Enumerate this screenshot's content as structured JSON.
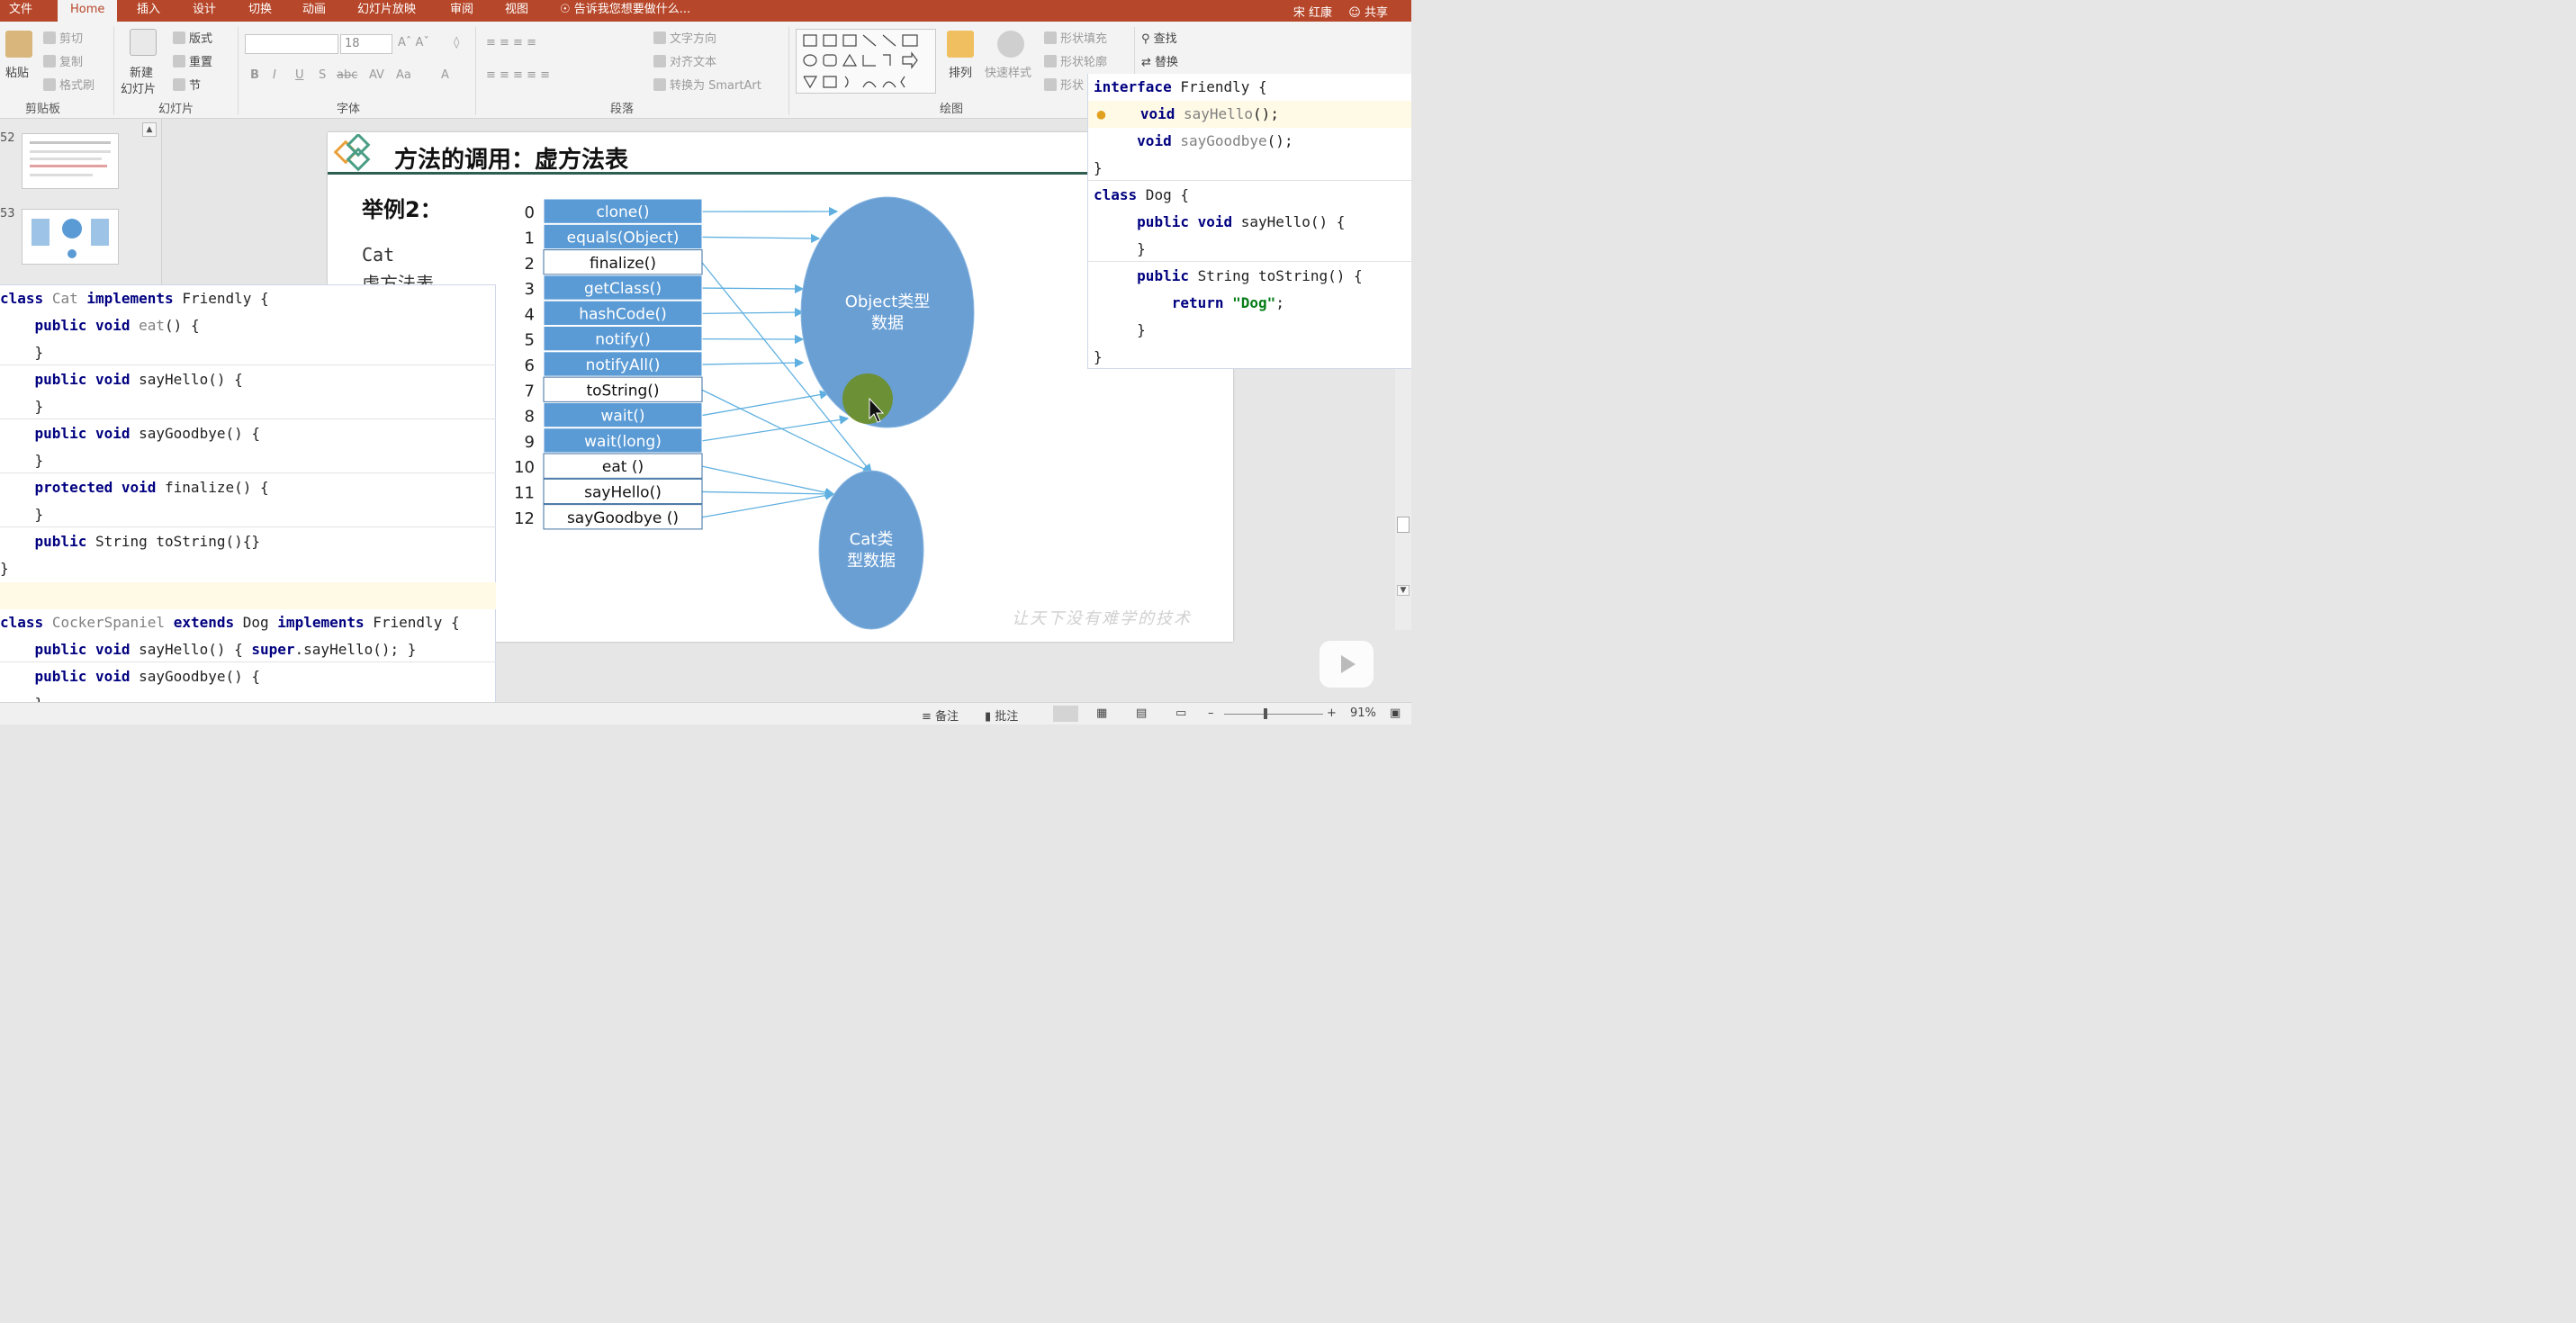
{
  "tabs": [
    "文件",
    "Home",
    "插入",
    "设计",
    "切换",
    "动画",
    "幻灯片放映",
    "审阅",
    "视图",
    "告诉我您想要做什么..."
  ],
  "user": "宋 红康",
  "share": "共享",
  "ribbon": {
    "paste": "粘贴",
    "cut": "剪切",
    "copy": "复制",
    "format_painter": "格式刷",
    "clipboard_group": "剪贴板",
    "new_slide": "新建",
    "new_slide2": "幻灯片",
    "layout": "版式",
    "reset": "重置",
    "section": "节",
    "slides_group": "幻灯片",
    "font_size": "18",
    "font_group": "字体",
    "text_direction": "文字方向",
    "align_text": "对齐文本",
    "smartart": "转换为 SmartArt",
    "paragraph_group": "段落",
    "arrange": "排列",
    "quick_styles": "快速样式",
    "shape_fill": "形状填充",
    "shape_outline": "形状轮廓",
    "shape_effects": "形状",
    "drawing_group": "绘图",
    "find": "查找",
    "replace": "替换"
  },
  "thumbs": [
    "52",
    "53"
  ],
  "slide": {
    "title": "方法的调用：虚方法表",
    "example": "举例2：",
    "cat_label": "Cat",
    "cat_label2": "虚方法表",
    "watermark": "让天下没有难学的技术",
    "object_circle_1": "Object类型",
    "object_circle_2": "数据",
    "cat_circle_1": "Cat类",
    "cat_circle_2": "型数据"
  },
  "vtable": [
    {
      "idx": "0",
      "name": "clone()",
      "inherited": true
    },
    {
      "idx": "1",
      "name": "equals(Object)",
      "inherited": true
    },
    {
      "idx": "2",
      "name": "finalize()",
      "inherited": false
    },
    {
      "idx": "3",
      "name": "getClass()",
      "inherited": true
    },
    {
      "idx": "4",
      "name": "hashCode()",
      "inherited": true
    },
    {
      "idx": "5",
      "name": "notify()",
      "inherited": true
    },
    {
      "idx": "6",
      "name": "notifyAll()",
      "inherited": true
    },
    {
      "idx": "7",
      "name": "toString()",
      "inherited": false
    },
    {
      "idx": "8",
      "name": "wait()",
      "inherited": true
    },
    {
      "idx": "9",
      "name": "wait(long)",
      "inherited": true
    },
    {
      "idx": "10",
      "name": "eat ()",
      "inherited": false
    },
    {
      "idx": "11",
      "name": "sayHello()",
      "inherited": false
    },
    {
      "idx": "12",
      "name": "sayGoodbye ()",
      "inherited": false
    }
  ],
  "code_left": [
    "class Cat implements Friendly {",
    "    public void eat() {",
    "    }",
    "    public void sayHello() {",
    "    }",
    "    public void sayGoodbye() {",
    "    }",
    "    protected void finalize() {",
    "    }",
    "    public String toString(){}",
    "}",
    "",
    "class CockerSpaniel extends Dog implements Friendly {",
    "    public void sayHello() { super.sayHello(); }",
    "    public void sayGoodbye() {",
    "    }"
  ],
  "code_right": [
    "interface Friendly {",
    "    void sayHello();",
    "    void sayGoodbye();",
    "}",
    "class Dog {",
    "    public void sayHello() {",
    "    }",
    "    public String toString() {",
    "        return \"Dog\";",
    "    }",
    "}"
  ],
  "status": {
    "notes": "备注",
    "comments": "批注",
    "zoom": "91%"
  },
  "colors": {
    "tab_bar": "#b7472a",
    "cell_fill": "#5b9bd5",
    "circle_fill": "#6a9fd4",
    "cursor_highlight": "#6b8e23"
  }
}
